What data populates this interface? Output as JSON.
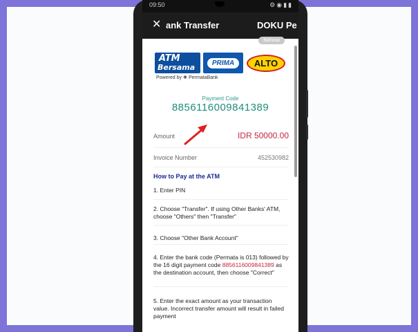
{
  "colors": {
    "page_border": "#7d73d8",
    "app_bar": "#1c1c1c",
    "payment_code": "#1f8c7c",
    "amount": "#c3273d",
    "howto_title": "#1c2b92"
  },
  "statusbar": {
    "time": "09:50",
    "icons": "⚙◉▮▮"
  },
  "appbar": {
    "close_icon": "close-icon",
    "close_glyph": "✕",
    "title": "ank Transfer",
    "merchant": "DOKU Pe"
  },
  "language_toggle": "Bahasa",
  "logos": {
    "atm_line1": "ATM",
    "atm_line2": "Bersama",
    "prima": "PRIMA",
    "alto": "ALTO",
    "powered_by": "Powered by ❖ PermataBank"
  },
  "payment": {
    "code_label": "Payment Code",
    "code": "8856116009841389"
  },
  "amount": {
    "label": "Amount",
    "value": "IDR  50000.00"
  },
  "invoice": {
    "label": "Invoice Number",
    "value": "452530982"
  },
  "howto": {
    "title": "How to Pay at the ATM",
    "steps": {
      "s1": "1. Enter PIN",
      "s2": "2. Choose \"Transfer\". If using Other Banks' ATM, choose \"Others\" then \"Transfer\"",
      "s3": "3. Choose \"Other Bank Account\"",
      "s4a": "4. Enter the bank code (Permata is 013) followed by the 16 digit payment code ",
      "s4code": "8856116009841389",
      "s4b": " as the destination account, then choose \"Correct\"",
      "s5": "5. Enter the exact amount as your transaction value. Incorrect transfer amount will result in failed payment"
    }
  }
}
